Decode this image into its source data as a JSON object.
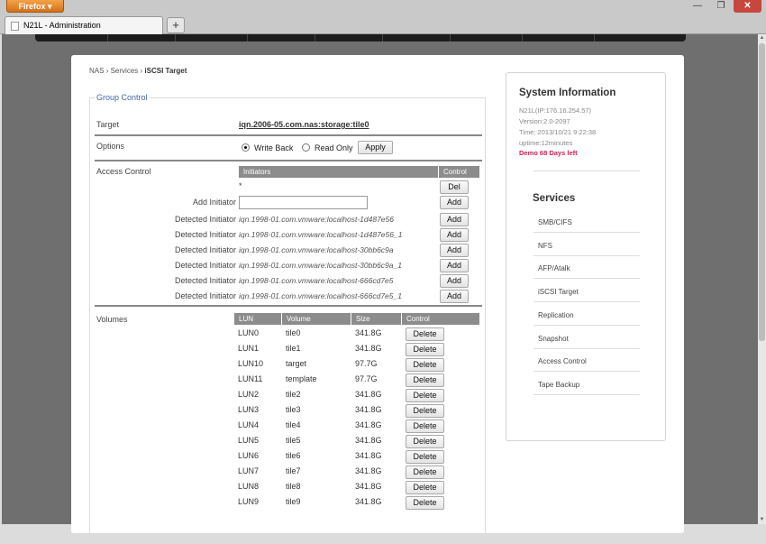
{
  "browser": {
    "menu_label": "Firefox ▾",
    "tab_title": "N21L - Administration",
    "new_tab": "+",
    "min": "—",
    "max": "❐",
    "close": "✕"
  },
  "breadcrumb": {
    "nas": "NAS",
    "services": "Services",
    "current": "iSCSI Target",
    "sep": "›"
  },
  "group": {
    "legend": "Group Control",
    "target_label": "Target",
    "target_value": "iqn.2006-05.com.nas:storage:tile0",
    "options_label": "Options",
    "write_back": "Write Back",
    "read_only": "Read Only",
    "apply": "Apply",
    "access_label": "Access Control",
    "initiators_header": "Initiators",
    "control_header": "Control",
    "star": "*",
    "del": "Del",
    "add_initiator": "Add Initiator",
    "add": "Add",
    "detected_label": "Detected Initiator",
    "detected": [
      "iqn.1998-01.com.vmware:localhost-1d487e56",
      "iqn.1998-01.com.vmware:localhost-1d487e56_1",
      "iqn.1998-01.com.vmware:localhost-30bb6c9a",
      "iqn.1998-01.com.vmware:localhost-30bb6c9a_1",
      "iqn.1998-01.com.vmware:localhost-666cd7e5",
      "iqn.1998-01.com.vmware:localhost-666cd7e5_1"
    ],
    "volumes_label": "Volumes",
    "col_lun": "LUN",
    "col_volume": "Volume",
    "col_size": "Size",
    "col_control": "Control",
    "delete": "Delete",
    "volumes": [
      [
        "LUN0",
        "tile0",
        "341.8G"
      ],
      [
        "LUN1",
        "tile1",
        "341.8G"
      ],
      [
        "LUN10",
        "target",
        "97.7G"
      ],
      [
        "LUN11",
        "template",
        "97.7G"
      ],
      [
        "LUN2",
        "tile2",
        "341.8G"
      ],
      [
        "LUN3",
        "tile3",
        "341.8G"
      ],
      [
        "LUN4",
        "tile4",
        "341.8G"
      ],
      [
        "LUN5",
        "tile5",
        "341.8G"
      ],
      [
        "LUN6",
        "tile6",
        "341.8G"
      ],
      [
        "LUN7",
        "tile7",
        "341.8G"
      ],
      [
        "LUN8",
        "tile8",
        "341.8G"
      ],
      [
        "LUN9",
        "tile9",
        "341.8G"
      ]
    ]
  },
  "sysinfo": {
    "title": "System Information",
    "host": "N21L(IP:176.16.254.57)",
    "version": "Version:2.0-2097",
    "time": "Time: 2013/10/21 9:22:38",
    "uptime": "uptime:12minutes",
    "demo": "Demo 68 Days left"
  },
  "services": {
    "title": "Services",
    "items": [
      "SMB/CIFS",
      "NFS",
      "AFP/Atalk",
      "iSCSI Target",
      "Replication",
      "Snapshot",
      "Access Control",
      "Tape Backup"
    ]
  }
}
